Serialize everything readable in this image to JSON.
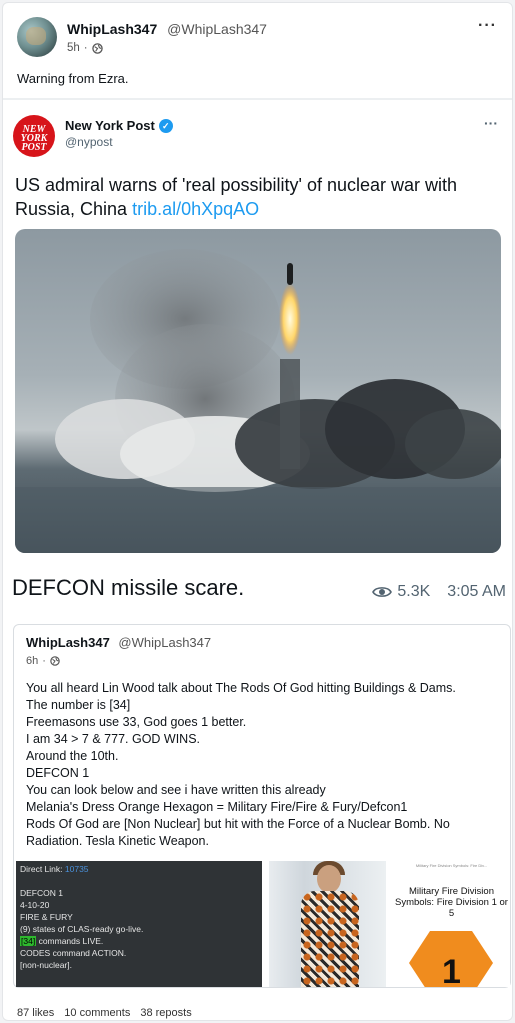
{
  "post": {
    "author_name": "WhipLash347",
    "author_handle": "@WhipLash347",
    "age": "5h",
    "more_icon": "more-horizontal-icon",
    "caption": "Warning from Ezra."
  },
  "embedded_tweet": {
    "logo_text": "NEW YORK POST",
    "name": "New York Post",
    "handle": "@nypost",
    "headline": "US admiral warns of 'real possibility' of nuclear war with Russia, China",
    "link": "trib.al/0hXpqAO",
    "title_overlay": "DEFCON missile scare.",
    "views": "5.3K",
    "time": "3:05 AM"
  },
  "quote": {
    "author_name": "WhipLash347",
    "author_handle": "@WhipLash347",
    "age": "6h",
    "lines": [
      "You all heard Lin Wood talk about The Rods Of God hitting Buildings & Dams.",
      "The number is [34]",
      "Freemasons use 33, God goes 1 better.",
      "I am 34 > 7 & 777. GOD WINS.",
      "Around the 10th.",
      "DEFCON 1",
      "You can look below and see i have written this already",
      "Melania's Dress Orange Hexagon = Military Fire/Fire & Fury/Defcon1",
      "Rods Of God are [Non Nuclear] but hit with the Force of a Nuclear Bomb. No Radiation. Tesla Kinetic Weapon."
    ],
    "thumb1": {
      "direct_link_label": "Direct Link:",
      "direct_link_value": "10735",
      "lines": [
        "DEFCON 1",
        "4-10-20",
        "FIRE & FURY",
        "(9) states of CLAS-ready go-live.",
        "commands LIVE.",
        "CODES command ACTION.",
        "[non-nuclear]."
      ],
      "highlight": "[34]"
    },
    "thumb3": {
      "small_text": "Military Fire Division Symbols: Fire Div...",
      "title": "Military Fire Division Symbols: Fire Division 1 or 5",
      "number": "1"
    }
  },
  "stats": {
    "likes": "87 likes",
    "comments": "10 comments",
    "reposts": "38 reposts"
  }
}
